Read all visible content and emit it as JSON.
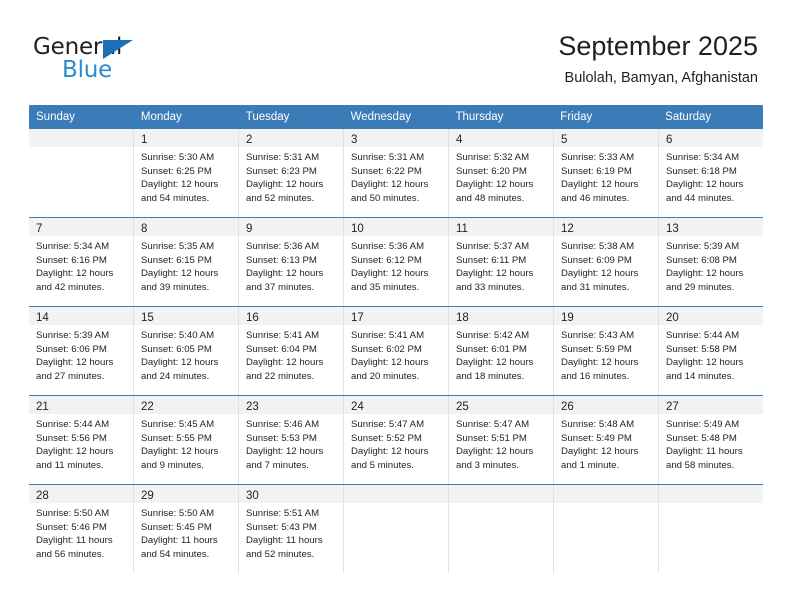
{
  "logo": {
    "word_top": "General",
    "word_bottom": "Blue",
    "triangle_color": "#1c70b8",
    "blue_color": "#2b8bd0"
  },
  "header": {
    "title": "September 2025",
    "subtitle": "Bulolah, Bamyan, Afghanistan"
  },
  "theme": {
    "header_row_bg": "#3b7cb8",
    "daynum_band_bg": "#f2f2f2",
    "grid_line": "#e2e2e2",
    "text": "#231f20"
  },
  "weekdays": [
    "Sunday",
    "Monday",
    "Tuesday",
    "Wednesday",
    "Thursday",
    "Friday",
    "Saturday"
  ],
  "weeks": [
    [
      {
        "day": "",
        "l1": "",
        "l2": "",
        "l3": "",
        "l4": ""
      },
      {
        "day": "1",
        "l1": "Sunrise: 5:30 AM",
        "l2": "Sunset: 6:25 PM",
        "l3": "Daylight: 12 hours",
        "l4": "and 54 minutes."
      },
      {
        "day": "2",
        "l1": "Sunrise: 5:31 AM",
        "l2": "Sunset: 6:23 PM",
        "l3": "Daylight: 12 hours",
        "l4": "and 52 minutes."
      },
      {
        "day": "3",
        "l1": "Sunrise: 5:31 AM",
        "l2": "Sunset: 6:22 PM",
        "l3": "Daylight: 12 hours",
        "l4": "and 50 minutes."
      },
      {
        "day": "4",
        "l1": "Sunrise: 5:32 AM",
        "l2": "Sunset: 6:20 PM",
        "l3": "Daylight: 12 hours",
        "l4": "and 48 minutes."
      },
      {
        "day": "5",
        "l1": "Sunrise: 5:33 AM",
        "l2": "Sunset: 6:19 PM",
        "l3": "Daylight: 12 hours",
        "l4": "and 46 minutes."
      },
      {
        "day": "6",
        "l1": "Sunrise: 5:34 AM",
        "l2": "Sunset: 6:18 PM",
        "l3": "Daylight: 12 hours",
        "l4": "and 44 minutes."
      }
    ],
    [
      {
        "day": "7",
        "l1": "Sunrise: 5:34 AM",
        "l2": "Sunset: 6:16 PM",
        "l3": "Daylight: 12 hours",
        "l4": "and 42 minutes."
      },
      {
        "day": "8",
        "l1": "Sunrise: 5:35 AM",
        "l2": "Sunset: 6:15 PM",
        "l3": "Daylight: 12 hours",
        "l4": "and 39 minutes."
      },
      {
        "day": "9",
        "l1": "Sunrise: 5:36 AM",
        "l2": "Sunset: 6:13 PM",
        "l3": "Daylight: 12 hours",
        "l4": "and 37 minutes."
      },
      {
        "day": "10",
        "l1": "Sunrise: 5:36 AM",
        "l2": "Sunset: 6:12 PM",
        "l3": "Daylight: 12 hours",
        "l4": "and 35 minutes."
      },
      {
        "day": "11",
        "l1": "Sunrise: 5:37 AM",
        "l2": "Sunset: 6:11 PM",
        "l3": "Daylight: 12 hours",
        "l4": "and 33 minutes."
      },
      {
        "day": "12",
        "l1": "Sunrise: 5:38 AM",
        "l2": "Sunset: 6:09 PM",
        "l3": "Daylight: 12 hours",
        "l4": "and 31 minutes."
      },
      {
        "day": "13",
        "l1": "Sunrise: 5:39 AM",
        "l2": "Sunset: 6:08 PM",
        "l3": "Daylight: 12 hours",
        "l4": "and 29 minutes."
      }
    ],
    [
      {
        "day": "14",
        "l1": "Sunrise: 5:39 AM",
        "l2": "Sunset: 6:06 PM",
        "l3": "Daylight: 12 hours",
        "l4": "and 27 minutes."
      },
      {
        "day": "15",
        "l1": "Sunrise: 5:40 AM",
        "l2": "Sunset: 6:05 PM",
        "l3": "Daylight: 12 hours",
        "l4": "and 24 minutes."
      },
      {
        "day": "16",
        "l1": "Sunrise: 5:41 AM",
        "l2": "Sunset: 6:04 PM",
        "l3": "Daylight: 12 hours",
        "l4": "and 22 minutes."
      },
      {
        "day": "17",
        "l1": "Sunrise: 5:41 AM",
        "l2": "Sunset: 6:02 PM",
        "l3": "Daylight: 12 hours",
        "l4": "and 20 minutes."
      },
      {
        "day": "18",
        "l1": "Sunrise: 5:42 AM",
        "l2": "Sunset: 6:01 PM",
        "l3": "Daylight: 12 hours",
        "l4": "and 18 minutes."
      },
      {
        "day": "19",
        "l1": "Sunrise: 5:43 AM",
        "l2": "Sunset: 5:59 PM",
        "l3": "Daylight: 12 hours",
        "l4": "and 16 minutes."
      },
      {
        "day": "20",
        "l1": "Sunrise: 5:44 AM",
        "l2": "Sunset: 5:58 PM",
        "l3": "Daylight: 12 hours",
        "l4": "and 14 minutes."
      }
    ],
    [
      {
        "day": "21",
        "l1": "Sunrise: 5:44 AM",
        "l2": "Sunset: 5:56 PM",
        "l3": "Daylight: 12 hours",
        "l4": "and 11 minutes."
      },
      {
        "day": "22",
        "l1": "Sunrise: 5:45 AM",
        "l2": "Sunset: 5:55 PM",
        "l3": "Daylight: 12 hours",
        "l4": "and 9 minutes."
      },
      {
        "day": "23",
        "l1": "Sunrise: 5:46 AM",
        "l2": "Sunset: 5:53 PM",
        "l3": "Daylight: 12 hours",
        "l4": "and 7 minutes."
      },
      {
        "day": "24",
        "l1": "Sunrise: 5:47 AM",
        "l2": "Sunset: 5:52 PM",
        "l3": "Daylight: 12 hours",
        "l4": "and 5 minutes."
      },
      {
        "day": "25",
        "l1": "Sunrise: 5:47 AM",
        "l2": "Sunset: 5:51 PM",
        "l3": "Daylight: 12 hours",
        "l4": "and 3 minutes."
      },
      {
        "day": "26",
        "l1": "Sunrise: 5:48 AM",
        "l2": "Sunset: 5:49 PM",
        "l3": "Daylight: 12 hours",
        "l4": "and 1 minute."
      },
      {
        "day": "27",
        "l1": "Sunrise: 5:49 AM",
        "l2": "Sunset: 5:48 PM",
        "l3": "Daylight: 11 hours",
        "l4": "and 58 minutes."
      }
    ],
    [
      {
        "day": "28",
        "l1": "Sunrise: 5:50 AM",
        "l2": "Sunset: 5:46 PM",
        "l3": "Daylight: 11 hours",
        "l4": "and 56 minutes."
      },
      {
        "day": "29",
        "l1": "Sunrise: 5:50 AM",
        "l2": "Sunset: 5:45 PM",
        "l3": "Daylight: 11 hours",
        "l4": "and 54 minutes."
      },
      {
        "day": "30",
        "l1": "Sunrise: 5:51 AM",
        "l2": "Sunset: 5:43 PM",
        "l3": "Daylight: 11 hours",
        "l4": "and 52 minutes."
      },
      {
        "day": "",
        "l1": "",
        "l2": "",
        "l3": "",
        "l4": ""
      },
      {
        "day": "",
        "l1": "",
        "l2": "",
        "l3": "",
        "l4": ""
      },
      {
        "day": "",
        "l1": "",
        "l2": "",
        "l3": "",
        "l4": ""
      },
      {
        "day": "",
        "l1": "",
        "l2": "",
        "l3": "",
        "l4": ""
      }
    ]
  ]
}
